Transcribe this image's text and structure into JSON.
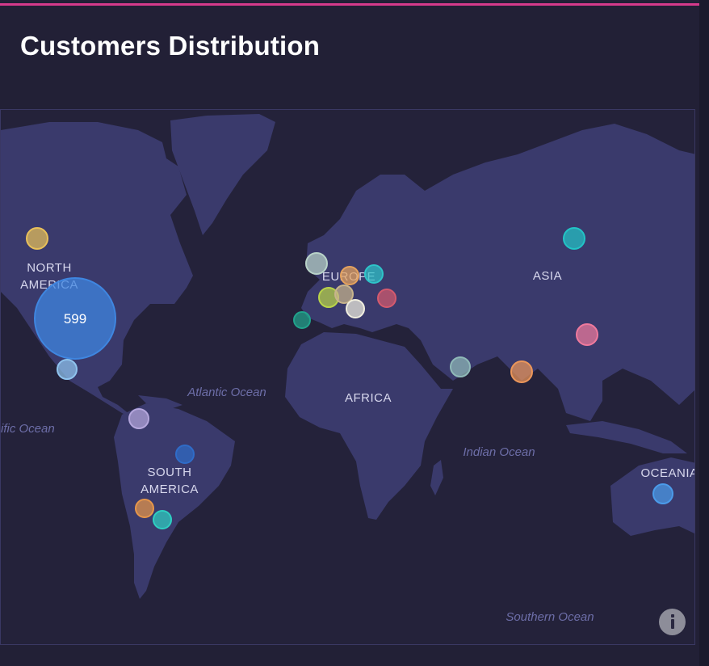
{
  "card": {
    "title": "Customers Distribution"
  },
  "map": {
    "continent_labels": {
      "north_america": [
        "NORTH",
        "AMERICA"
      ],
      "europe": "EUROPE",
      "asia": "ASIA",
      "africa": "AFRICA",
      "south_america": [
        "SOUTH",
        "AMERICA"
      ],
      "oceania": "OCEANIA"
    },
    "ocean_labels": {
      "atlantic": "Atlantic Ocean",
      "pacific": "ific Ocean",
      "indian": "Indian Ocean",
      "southern": "Southern Ocean"
    },
    "markers": [
      {
        "region": "Canada",
        "color": "#e8c05a"
      },
      {
        "region": "United States",
        "color": "#3f86e0",
        "value": "599"
      },
      {
        "region": "Mexico",
        "color": "#8fc3ee"
      },
      {
        "region": "Colombia",
        "color": "#b4a6dc"
      },
      {
        "region": "Brazil",
        "color": "#2f6cc8"
      },
      {
        "region": "Chile",
        "color": "#e6964a"
      },
      {
        "region": "Argentina",
        "color": "#2ecfc2"
      },
      {
        "region": "United Kingdom",
        "color": "#b8d2c8"
      },
      {
        "region": "Germany",
        "color": "#e6a35e"
      },
      {
        "region": "Poland",
        "color": "#2ec4c9"
      },
      {
        "region": "France",
        "color": "#b9d34a"
      },
      {
        "region": "Switzerland",
        "color": "#c8b48c"
      },
      {
        "region": "Italy",
        "color": "#f0eedf"
      },
      {
        "region": "Ukraine",
        "color": "#d45a6e"
      },
      {
        "region": "Spain",
        "color": "#21a38c"
      },
      {
        "region": "Russia",
        "color": "#22c4c6"
      },
      {
        "region": "China",
        "color": "#ef7a9d"
      },
      {
        "region": "Saudi Arabia",
        "color": "#8fb9b8"
      },
      {
        "region": "India",
        "color": "#eb965a"
      },
      {
        "region": "Australia",
        "color": "#4b9bea"
      }
    ]
  },
  "info_icon": "info-icon",
  "colors": {
    "background": "#222036",
    "land": "#3a3a6c",
    "accent_line": "#d63a8c"
  }
}
